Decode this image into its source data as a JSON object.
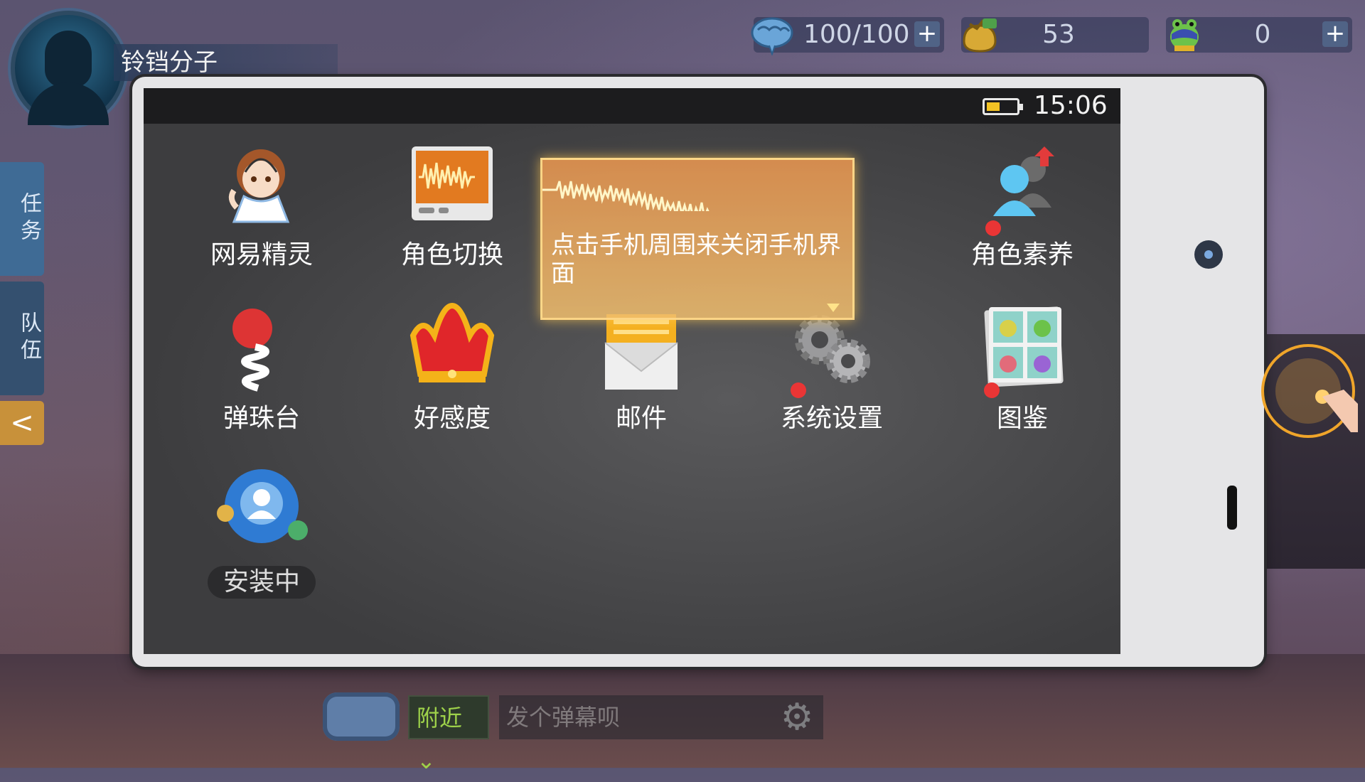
{
  "player": {
    "name": "铃铛分子"
  },
  "resources": {
    "energy": {
      "icon": "brain-icon",
      "value": "100/100",
      "plus": "+"
    },
    "coins": {
      "icon": "coin-pouch-icon",
      "value": "53"
    },
    "frogs": {
      "icon": "frog-icon",
      "value": "0",
      "plus": "+"
    }
  },
  "sidebar": {
    "task_label": "任务",
    "team_label": "队伍",
    "collapse_icon": "chevron-left-icon",
    "collapse_glyph": "<"
  },
  "phone": {
    "time": "15:06",
    "battery_level": 0.45,
    "battery_color": "#f3c324",
    "apps": [
      {
        "label": "网易精灵",
        "icon": "sprite-girl-icon"
      },
      {
        "label": "角色切换",
        "icon": "soundwave-monitor-icon"
      },
      {
        "label": "角色素养",
        "icon": "character-upgrade-icon"
      },
      {
        "label": "弹珠台",
        "icon": "pinball-spring-icon"
      },
      {
        "label": "好感度",
        "icon": "crown-icon"
      },
      {
        "label": "邮件",
        "icon": "mail-envelope-icon"
      },
      {
        "label": "系统设置",
        "icon": "gears-icon"
      },
      {
        "label": "图鉴",
        "icon": "frog-album-icon"
      },
      {
        "label": "安装中",
        "icon": "social-avatar-icon"
      }
    ],
    "tooltip": "点击手机周围来关闭手机界面"
  },
  "chat": {
    "channel": "附近",
    "placeholder": "发个弹幕呗"
  },
  "colors": {
    "accent_gold": "#f3c324",
    "tab_blue": "#3f6b95",
    "collapse_orange": "#c8913a",
    "channel_green": "#9ed24a"
  }
}
